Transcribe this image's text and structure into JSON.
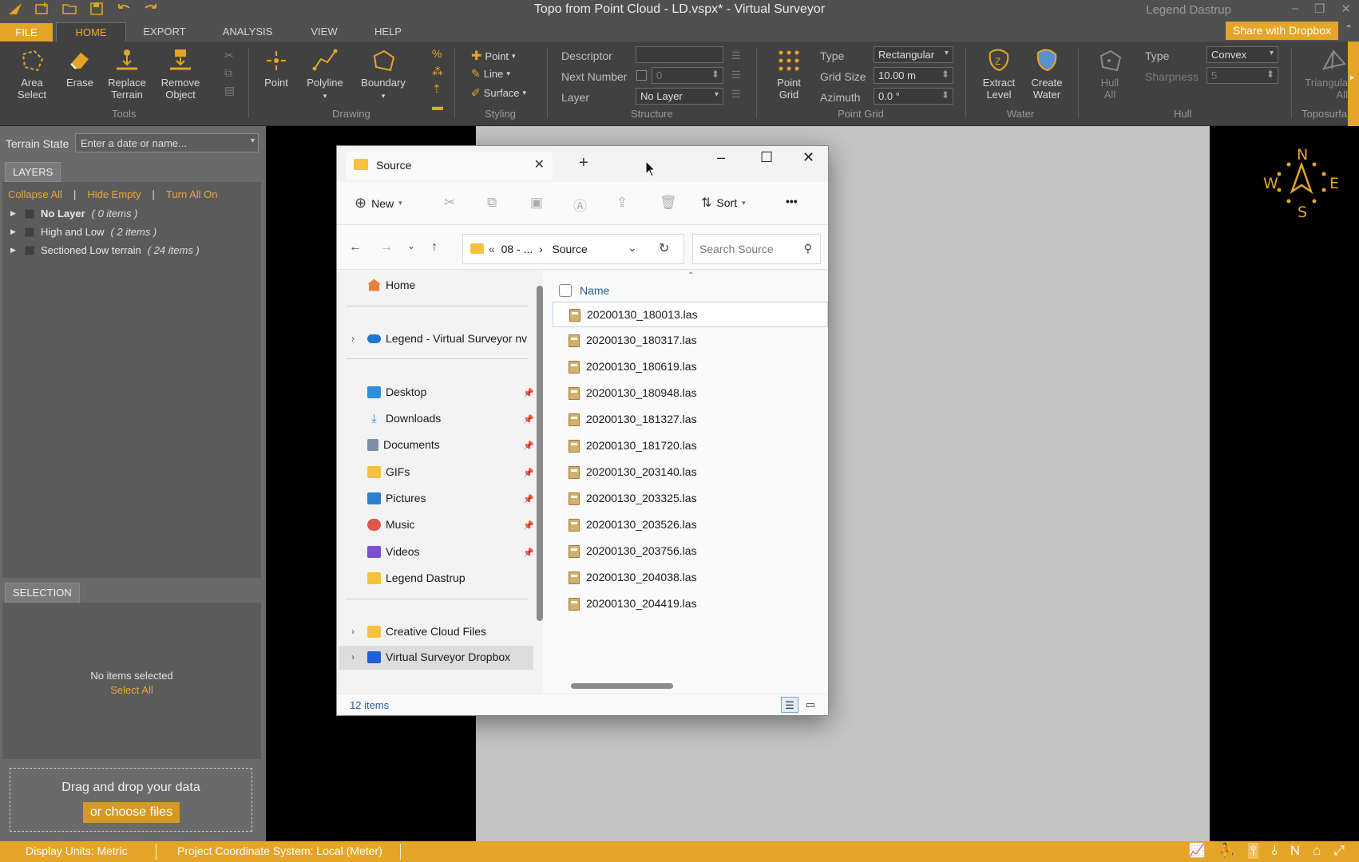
{
  "app": {
    "title": "Topo from Point Cloud - LD.vspx*  -  Virtual Surveyor",
    "user": "Legend Dastrup",
    "share_button": "Share with Dropbox",
    "accent_color": "#e5a526"
  },
  "quick_access": [
    "app-logo-icon",
    "new-icon",
    "open-icon",
    "save-icon",
    "undo-icon",
    "redo-icon"
  ],
  "menu": {
    "tabs": [
      "FILE",
      "HOME",
      "EXPORT",
      "ANALYSIS",
      "VIEW",
      "HELP"
    ],
    "active": "HOME"
  },
  "ribbon": {
    "tools": {
      "area_select": [
        "Area",
        "Select"
      ],
      "erase": "Erase",
      "replace_terrain": [
        "Replace",
        "Terrain"
      ],
      "remove_object": [
        "Remove",
        "Object"
      ],
      "label": "Tools"
    },
    "drawing": {
      "point": "Point",
      "polyline": "Polyline",
      "boundary": "Boundary",
      "label": "Drawing"
    },
    "styling": {
      "point": "Point",
      "line": "Line",
      "surface": "Surface",
      "label": "Styling"
    },
    "structure": {
      "descriptor_label": "Descriptor",
      "next_number_label": "Next Number",
      "next_number_value": "0",
      "layer_label": "Layer",
      "layer_value": "No Layer",
      "label": "Structure"
    },
    "point_grid": {
      "button": [
        "Point",
        "Grid"
      ],
      "type_label": "Type",
      "type_value": "Rectangular",
      "grid_size_label": "Grid Size",
      "grid_size_value": "10.00 m",
      "azimuth_label": "Azimuth",
      "azimuth_value": "0.0 °",
      "label": "Point Grid"
    },
    "water": {
      "extract_level": [
        "Extract",
        "Level"
      ],
      "create_water": [
        "Create",
        "Water"
      ],
      "label": "Water"
    },
    "hull": {
      "hull_all": [
        "Hull",
        "All"
      ],
      "type_label": "Type",
      "type_value": "Convex",
      "sharpness_label": "Sharpness",
      "sharpness_value": "5",
      "label": "Hull"
    },
    "toposurface": {
      "triangulate_all": [
        "Triangula",
        "All"
      ],
      "label": "Toposurfa"
    }
  },
  "left_panel": {
    "terrain_state_label": "Terrain State",
    "terrain_state_placeholder": "Enter a date or name...",
    "layers_tab": "LAYERS",
    "layer_links": {
      "collapse_all": "Collapse All",
      "hide_empty": "Hide Empty",
      "turn_all_on": "Turn All On"
    },
    "layers": [
      {
        "name": "No Layer",
        "count": "( 0 items )",
        "bold": true
      },
      {
        "name": "High and Low",
        "count": "( 2 items )",
        "bold": false
      },
      {
        "name": "Sectioned Low terrain",
        "count": "( 24 items )",
        "bold": false
      }
    ],
    "selection_tab": "SELECTION",
    "no_items": "No items selected",
    "select_all": "Select All",
    "drop_text": "Drag and drop your data",
    "choose_files": "or choose files"
  },
  "compass": {
    "n": "N",
    "s": "S",
    "w": "W",
    "e": "E"
  },
  "status_bar": {
    "display_units": "Display Units: Metric",
    "coord_system": "Project Coordinate System:  Local (Meter)"
  },
  "file_dialog": {
    "tab_title": "Source",
    "toolbar": {
      "new": "New",
      "sort": "Sort",
      "more": "•••"
    },
    "address": {
      "path_prefix": "«",
      "path_parent": "08 - ...",
      "path_current": "Source"
    },
    "search_placeholder": "Search Source",
    "nav": {
      "home": "Home",
      "cloud": "Legend - Virtual Surveyor nv",
      "quick": [
        "Desktop",
        "Downloads",
        "Documents",
        "GIFs",
        "Pictures",
        "Music",
        "Videos",
        "Legend Dastrup"
      ],
      "creative_cloud": "Creative Cloud Files",
      "dropbox": "Virtual Surveyor Dropbox"
    },
    "column_name": "Name",
    "files": [
      "20200130_180013.las",
      "20200130_180317.las",
      "20200130_180619.las",
      "20200130_180948.las",
      "20200130_181327.las",
      "20200130_181720.las",
      "20200130_203140.las",
      "20200130_203325.las",
      "20200130_203526.las",
      "20200130_203756.las",
      "20200130_204038.las",
      "20200130_204419.las"
    ],
    "item_count": "12 items"
  }
}
